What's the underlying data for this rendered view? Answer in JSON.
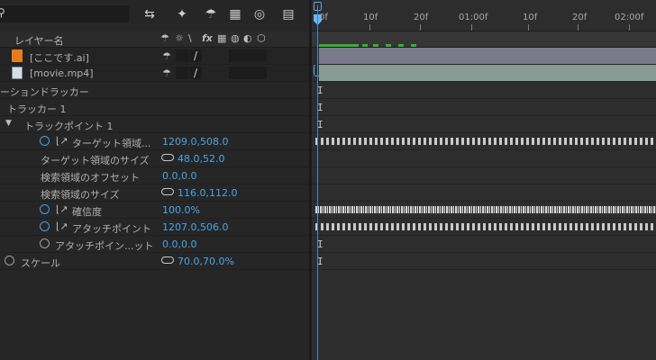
{
  "panel": {
    "column_header": "レイヤー名",
    "toolbar_icons": [
      "comp-flow-icon",
      "draft-3d-icon",
      "shy-icon",
      "frame-blending-icon",
      "motion-blur-icon",
      "graph-editor-icon"
    ]
  },
  "layers": [
    {
      "name": "[ここです.ai]",
      "bar_color": "#7a7a8c"
    },
    {
      "name": "[movie.mp4]",
      "bar_color": "#8a9a94"
    }
  ],
  "properties": [
    {
      "label": "ーションドラッカー"
    },
    {
      "label": "トラッカー 1"
    },
    {
      "label": "トラックポイント 1"
    },
    {
      "label": "ターゲット領域...",
      "value": "1209.0,508.0"
    },
    {
      "label": "ターゲット領域のサイズ",
      "value": "48.0,52.0"
    },
    {
      "label": "検索領域のオフセット",
      "value": "0.0,0.0"
    },
    {
      "label": "検索領域のサイズ",
      "value": "116.0,112.0"
    },
    {
      "label": "確信度",
      "value": "100.0%"
    },
    {
      "label": "アタッチポイント",
      "value": "1207.0,506.0"
    },
    {
      "label": "アタッチポイン...ット",
      "value": "0.0,0.0"
    },
    {
      "label": "スケール",
      "value": "70.0,70.0%"
    }
  ],
  "timeline": {
    "ticks": [
      "0f",
      "10f",
      "20f",
      "01:00f",
      "10f",
      "20f",
      "02:00f"
    ]
  }
}
